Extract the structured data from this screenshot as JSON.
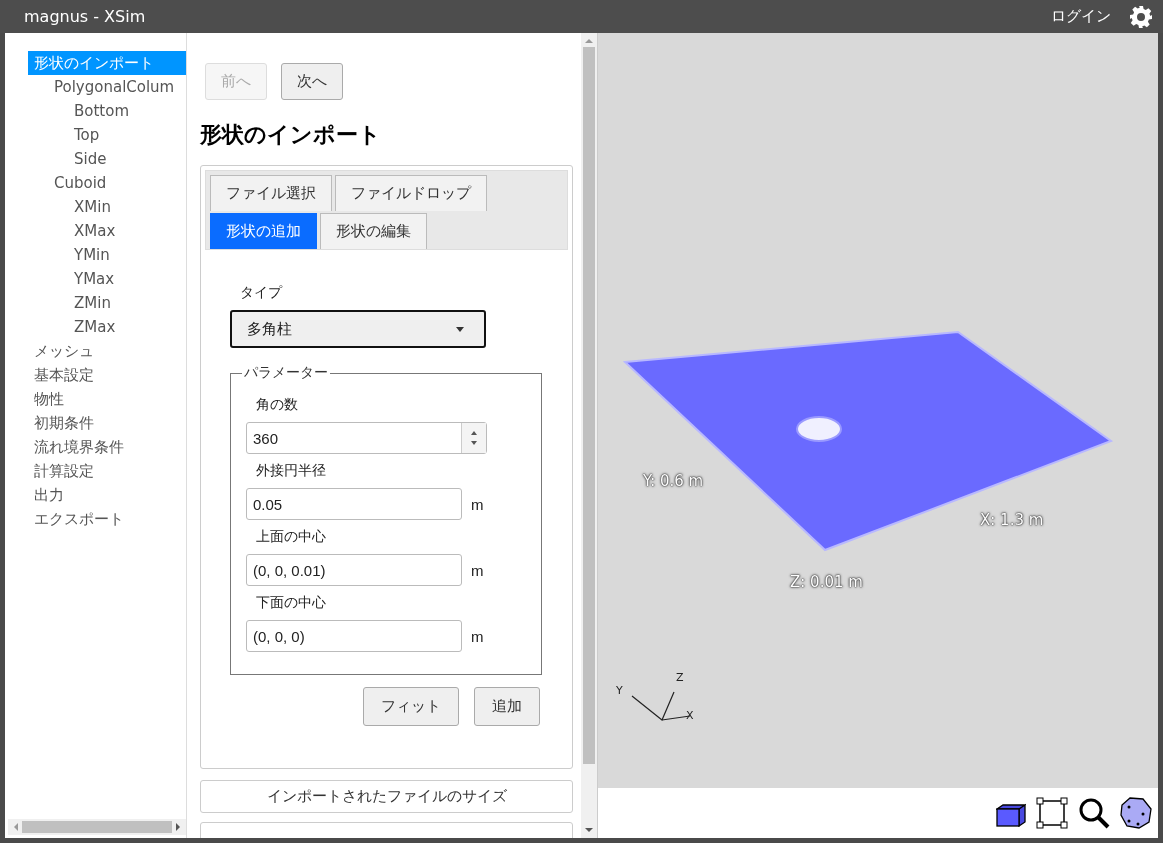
{
  "window": {
    "title": "magnus - XSim"
  },
  "header": {
    "login": "ログイン"
  },
  "sidebar": {
    "tree": [
      {
        "label": "形状のインポート",
        "selected": true,
        "children": [
          {
            "label": "PolygonalColum",
            "selected": false,
            "children": [
              {
                "label": "Bottom",
                "selected": false
              },
              {
                "label": "Top",
                "selected": false
              },
              {
                "label": "Side",
                "selected": false
              }
            ]
          },
          {
            "label": "Cuboid",
            "selected": false,
            "children": [
              {
                "label": "XMin",
                "selected": false
              },
              {
                "label": "XMax",
                "selected": false
              },
              {
                "label": "YMin",
                "selected": false
              },
              {
                "label": "YMax",
                "selected": false
              },
              {
                "label": "ZMin",
                "selected": false
              },
              {
                "label": "ZMax",
                "selected": false
              }
            ]
          }
        ]
      },
      {
        "label": "メッシュ",
        "selected": false
      },
      {
        "label": "基本設定",
        "selected": false
      },
      {
        "label": "物性",
        "selected": false
      },
      {
        "label": "初期条件",
        "selected": false
      },
      {
        "label": "流れ境界条件",
        "selected": false
      },
      {
        "label": "計算設定",
        "selected": false
      },
      {
        "label": "出力",
        "selected": false
      },
      {
        "label": "エクスポート",
        "selected": false
      }
    ]
  },
  "nav": [
    {
      "label": "前へ",
      "disabled": true
    },
    {
      "label": "次へ",
      "disabled": false
    }
  ],
  "title": "形状のインポート",
  "tab_rows": [
    [
      {
        "label": "ファイル選択",
        "selected": false
      },
      {
        "label": "ファイルドロップ",
        "selected": false
      }
    ],
    [
      {
        "label": "形状の追加",
        "selected": true
      },
      {
        "label": "形状の編集",
        "selected": false
      }
    ]
  ],
  "type_field": {
    "label": "タイプ",
    "value": "多角柱"
  },
  "parameters": {
    "legend": "パラメーター",
    "fields": [
      {
        "kind": "number",
        "label": "角の数",
        "value": "360"
      },
      {
        "kind": "text",
        "label": "外接円半径",
        "value": "0.05",
        "unit": "m"
      },
      {
        "kind": "text",
        "label": "上面の中心",
        "value": "(0, 0, 0.01)",
        "unit": "m"
      },
      {
        "kind": "text",
        "label": "下面の中心",
        "value": "(0, 0, 0)",
        "unit": "m"
      }
    ]
  },
  "actions": [
    "フィット",
    "追加"
  ],
  "sections": [
    {
      "label": "インポートされたファイルのサイズ"
    }
  ],
  "viewer": {
    "dimension_labels": [
      "Y: 0.6 m",
      "X: 1.3 m",
      "Z: 0.01 m"
    ],
    "axes": [
      "Y",
      "Z",
      "X"
    ]
  }
}
